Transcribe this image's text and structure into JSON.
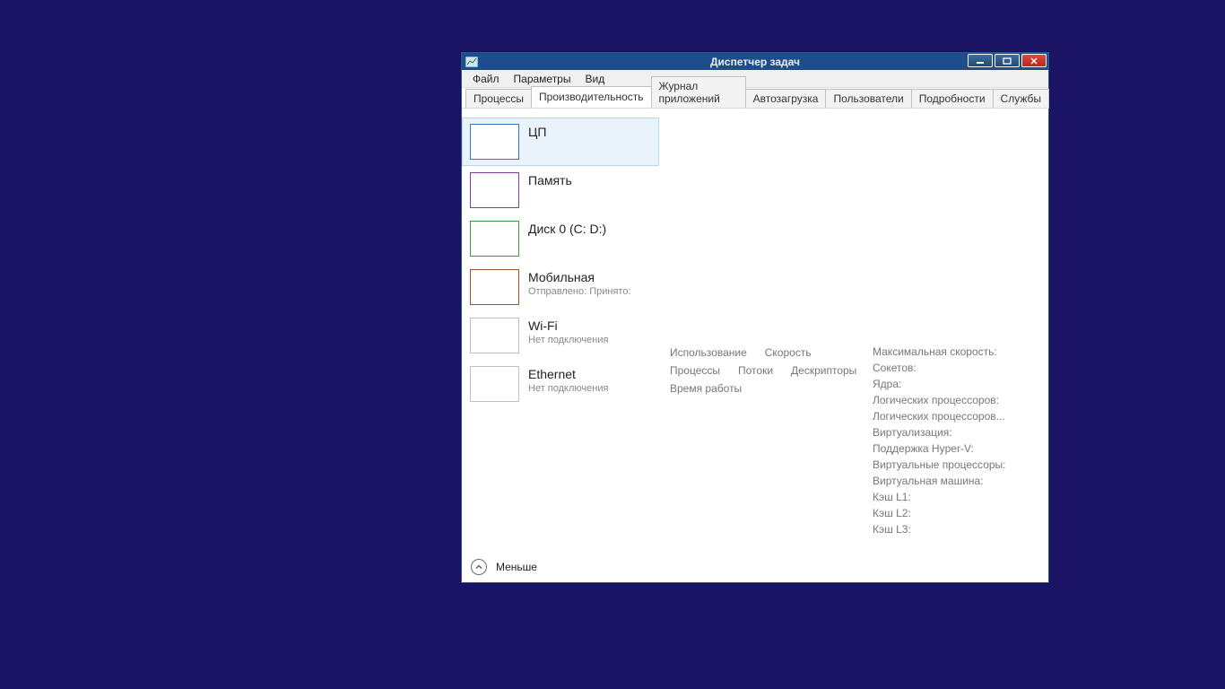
{
  "window": {
    "title": "Диспетчер задач"
  },
  "menubar": {
    "file": "Файл",
    "options": "Параметры",
    "view": "Вид"
  },
  "tabs": {
    "processes": "Процессы",
    "performance": "Производительность",
    "app_history": "Журнал приложений",
    "startup": "Автозагрузка",
    "users": "Пользователи",
    "details": "Подробности",
    "services": "Службы"
  },
  "sidebar": {
    "cpu": {
      "title": "ЦП"
    },
    "memory": {
      "title": "Память"
    },
    "disk": {
      "title": "Диск 0 (C: D:)"
    },
    "mobile": {
      "title": "Мобильная",
      "sub": "Отправлено:  Принято:"
    },
    "wifi": {
      "title": "Wi-Fi",
      "sub": "Нет подключения"
    },
    "ethernet": {
      "title": "Ethernet",
      "sub": "Нет подключения"
    }
  },
  "stats_left": {
    "utilization": "Использование",
    "speed": "Скорость",
    "processes": "Процессы",
    "threads": "Потоки",
    "handles": "Дескрипторы",
    "uptime": "Время работы"
  },
  "stats_right": {
    "max_speed": "Максимальная скорость:",
    "sockets": "Сокетов:",
    "cores": "Ядра:",
    "logical_processors": "Логических процессоров:",
    "logical_processors_ellipsis": "Логических процессоров...",
    "virtualization": "Виртуализация:",
    "hyperv": "Поддержка Hyper-V:",
    "virtual_processors": "Виртуальные процессоры:",
    "virtual_machine": "Виртуальная машина:",
    "l1": "Кэш L1:",
    "l2": "Кэш L2:",
    "l3": "Кэш L3:"
  },
  "footer": {
    "fewer": "Меньше"
  }
}
